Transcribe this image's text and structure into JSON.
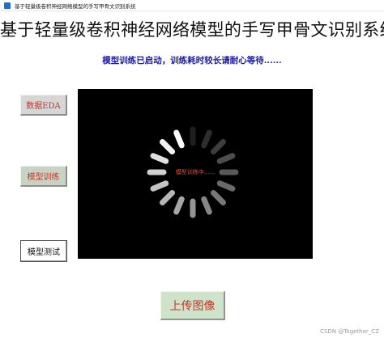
{
  "window": {
    "title": "基于轻量级卷积神经网络模型的手写甲骨文识别系统",
    "icon": "app-feather-icon"
  },
  "header": {
    "title": "基于轻量级卷积神经网络模型的手写甲骨文识别系统"
  },
  "status": {
    "message": "模型训练已启动，训练耗时较长请耐心等待......"
  },
  "sidebar": {
    "eda_label": "数据EDA",
    "train_label": "模型训练",
    "test_label": "模型测试"
  },
  "display": {
    "loading_text": "模型训练中......",
    "spinner_icon": "loading-spinner-icon"
  },
  "actions": {
    "upload_label": "上传图像"
  },
  "footer": {
    "watermark": "CSDN @Together_CZ"
  },
  "colors": {
    "title_text": "#111111",
    "status_text": "#1a1aa6",
    "button_red_text": "#c0392b",
    "display_bg": "#000000",
    "loading_text": "#e14a3a"
  }
}
